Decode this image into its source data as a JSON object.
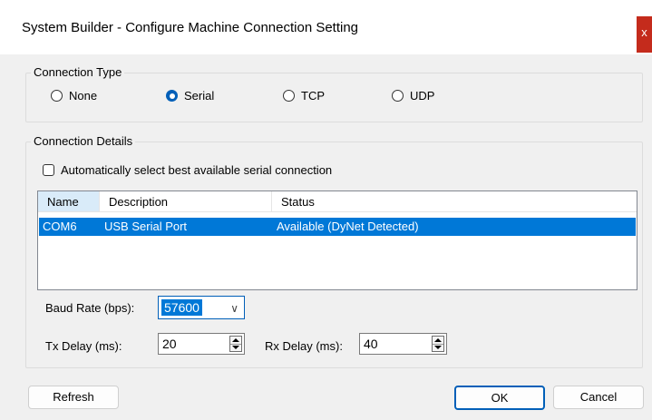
{
  "window": {
    "title": "System Builder - Configure Machine Connection Setting",
    "close_glyph": "x"
  },
  "connection_type": {
    "legend": "Connection Type",
    "options": [
      {
        "label": "None",
        "checked": false
      },
      {
        "label": "Serial",
        "checked": true
      },
      {
        "label": "TCP",
        "checked": false
      },
      {
        "label": "UDP",
        "checked": false
      }
    ]
  },
  "connection_details": {
    "legend": "Connection Details",
    "auto_select_label": "Automatically select best available serial connection",
    "auto_select_checked": false,
    "table": {
      "columns": [
        "Name",
        "Description",
        "Status"
      ],
      "rows": [
        {
          "name": "COM6",
          "description": "USB Serial Port",
          "status": "Available (DyNet Detected)",
          "selected": true
        }
      ]
    },
    "baud_rate_label": "Baud Rate (bps):",
    "baud_rate_value": "57600",
    "tx_delay_label": "Tx Delay (ms):",
    "tx_delay_value": "20",
    "rx_delay_label": "Rx Delay (ms):",
    "rx_delay_value": "40"
  },
  "buttons": {
    "refresh": "Refresh",
    "ok": "OK",
    "cancel": "Cancel"
  },
  "colors": {
    "accent": "#005fb8",
    "selection": "#0078d7",
    "close": "#c42b1c",
    "dialog_bg": "#f0f0f0"
  },
  "icons": {
    "close": "close-icon",
    "combo_arrow": "chevron-down-icon",
    "spin": "spin-up-down-icon"
  }
}
